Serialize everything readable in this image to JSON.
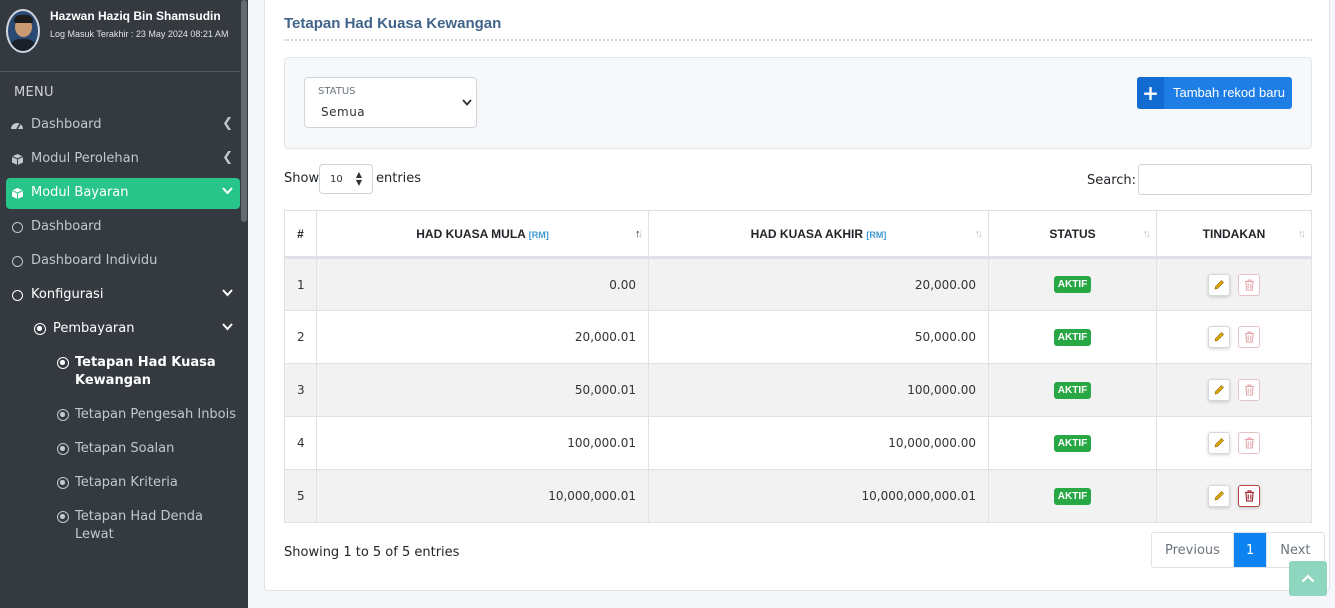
{
  "user": {
    "name": "Hazwan Haziq Bin Shamsudin",
    "last_login": "Log Masuk Terakhir : 23 May 2024 08:21 AM"
  },
  "sidebar": {
    "menu_header": "MENU",
    "items": [
      {
        "label": "Dashboard",
        "icon": "gauge-icon"
      },
      {
        "label": "Modul Perolehan",
        "icon": "box-icon"
      },
      {
        "label": "Modul Bayaran",
        "icon": "box-icon",
        "active": true
      },
      {
        "label": "Dashboard",
        "icon": "circle-icon"
      },
      {
        "label": "Dashboard Individu",
        "icon": "circle-icon"
      },
      {
        "label": "Konfigurasi",
        "icon": "circle-icon"
      },
      {
        "label": "Pembayaran",
        "icon": "dot-circle-icon"
      },
      {
        "label": "Tetapan Had Kuasa Kewangan",
        "icon": "dot-circle-icon"
      },
      {
        "label": "Tetapan Pengesah Inbois",
        "icon": "dot-circle-icon"
      },
      {
        "label": "Tetapan Soalan",
        "icon": "dot-circle-icon"
      },
      {
        "label": "Tetapan Kriteria",
        "icon": "dot-circle-icon"
      },
      {
        "label": "Tetapan Had Denda Lewat",
        "icon": "dot-circle-icon"
      }
    ],
    "active_color": "#28c58b"
  },
  "page": {
    "title": "Tetapan Had Kuasa Kewangan"
  },
  "filter": {
    "status_label": "STATUS",
    "status_value": "Semua",
    "add_button": "Tambah rekod baru"
  },
  "table_controls": {
    "show": "Show",
    "length": "10",
    "entries": "entries",
    "search_label": "Search:",
    "search_value": ""
  },
  "table": {
    "columns": [
      {
        "label": "#"
      },
      {
        "label": "HAD KUASA MULA",
        "unit": "[RM]"
      },
      {
        "label": "HAD KUASA AKHIR",
        "unit": "[RM]"
      },
      {
        "label": "STATUS"
      },
      {
        "label": "TINDAKAN"
      }
    ],
    "rows": [
      {
        "no": "1",
        "mula": "0.00",
        "akhir": "20,000.00",
        "status": "AKTIF"
      },
      {
        "no": "2",
        "mula": "20,000.01",
        "akhir": "50,000.00",
        "status": "AKTIF"
      },
      {
        "no": "3",
        "mula": "50,000.01",
        "akhir": "100,000.00",
        "status": "AKTIF"
      },
      {
        "no": "4",
        "mula": "100,000.01",
        "akhir": "10,000,000.00",
        "status": "AKTIF"
      },
      {
        "no": "5",
        "mula": "10,000,000.01",
        "akhir": "10,000,000,000.01",
        "status": "AKTIF"
      }
    ]
  },
  "footer": {
    "info": "Showing 1 to 5 of 5 entries",
    "previous": "Previous",
    "current_page": "1",
    "next": "Next"
  },
  "colors": {
    "badge": "#28a745",
    "primary": "#1e7ee6",
    "title": "#41648a"
  }
}
